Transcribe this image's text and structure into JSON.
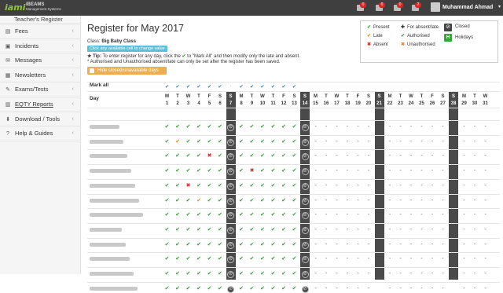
{
  "header": {
    "logo_text": "iami",
    "logo_line1": "iBEAMS",
    "logo_line2": "Management Systems",
    "notifications": [
      {
        "icon": "alert-icon",
        "count": "0"
      },
      {
        "icon": "bell-icon",
        "count": "0"
      },
      {
        "icon": "envelope-icon",
        "count": "0"
      },
      {
        "icon": "message-icon",
        "count": "2"
      }
    ],
    "user_name": "Muhammad Ahmad"
  },
  "sidebar": {
    "top_item": "Teacher's Register",
    "items": [
      {
        "icon": "fees-icon",
        "label": "Fees",
        "underline": false
      },
      {
        "icon": "incidents-icon",
        "label": "Incidents",
        "underline": false
      },
      {
        "icon": "messages-icon",
        "label": "Messages",
        "underline": false
      },
      {
        "icon": "newsletters-icon",
        "label": "Newsletters",
        "underline": false
      },
      {
        "icon": "exams-icon",
        "label": "Exams/Tests",
        "underline": false
      },
      {
        "icon": "eqty-icon",
        "label": "EQTY Reports",
        "underline": true
      },
      {
        "icon": "download-icon",
        "label": "Download / Tools",
        "underline": false
      },
      {
        "icon": "help-icon",
        "label": "Help & Guides",
        "underline": false
      }
    ]
  },
  "main": {
    "title": "Register for May 2017",
    "class_label": "Class:",
    "class_name": "Big Baby Class",
    "hint": "Click any available cell to change value",
    "tip_prefix": "Tip:",
    "tip_text_a": "To enter register for any day, click the",
    "tip_text_b": "to \"Mark All\" and then modify only the late and absent.",
    "note": "* Authorised and Unauthorised absent/late can only be set after the register has been saved.",
    "hide_label": "Hide closed/unavailable days"
  },
  "legend": {
    "items": [
      {
        "mark": "✔",
        "tone": "g",
        "label": "Present"
      },
      {
        "mark": "✔",
        "tone": "o",
        "label": "Late"
      },
      {
        "mark": "✖",
        "tone": "r",
        "label": "Absent"
      },
      {
        "mark": "✚",
        "tone": "k",
        "label": "For absent/late"
      },
      {
        "mark": "✔",
        "tone": "g",
        "label": "Authorised"
      },
      {
        "mark": "✖",
        "tone": "o",
        "label": "Unauthorised"
      }
    ],
    "closed_label": "Closed",
    "holidays_label": "Holidays",
    "holiday_mark": "H"
  },
  "register": {
    "mark_all_label": "Mark all",
    "day_label": "Day",
    "letters": [
      "M",
      "T",
      "W",
      "T",
      "F",
      "S",
      "S",
      "M",
      "T",
      "W",
      "T",
      "F",
      "S",
      "S",
      "M",
      "T",
      "W",
      "T",
      "F",
      "S",
      "S",
      "M",
      "T",
      "W",
      "T",
      "F",
      "S",
      "S",
      "M",
      "T",
      "W"
    ],
    "dates": [
      "1",
      "2",
      "3",
      "4",
      "5",
      "6",
      "7",
      "8",
      "9",
      "10",
      "11",
      "12",
      "13",
      "14",
      "15",
      "16",
      "17",
      "18",
      "19",
      "20",
      "21",
      "22",
      "23",
      "24",
      "25",
      "26",
      "27",
      "28",
      "29",
      "30",
      "31"
    ],
    "closed_days": [
      7,
      14
    ],
    "shaded_days": [
      21,
      28
    ],
    "student_count": 12,
    "exceptions": [
      {
        "row": 1,
        "day": 2,
        "status": "L"
      },
      {
        "row": 2,
        "day": 5,
        "status": "A"
      },
      {
        "row": 3,
        "day": 9,
        "status": "A"
      },
      {
        "row": 4,
        "day": 3,
        "status": "A"
      },
      {
        "row": 5,
        "day": 4,
        "status": "L"
      }
    ],
    "recorded_through": 13,
    "marks": {
      "P": "✔",
      "L": "✔",
      "A": "✖",
      "closed": "⊘",
      "blank": "-"
    }
  }
}
